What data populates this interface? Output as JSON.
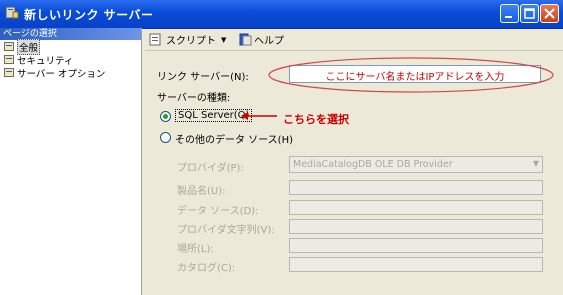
{
  "window": {
    "title": "新しいリンク サーバー"
  },
  "sidebar": {
    "header": "ページの選択",
    "items": [
      {
        "label": "全般"
      },
      {
        "label": "セキュリティ"
      },
      {
        "label": "サーバー オプション"
      }
    ]
  },
  "toolbar": {
    "script_label": "スクリプト",
    "help_label": "ヘルプ"
  },
  "form": {
    "linked_server_label": "リンク サーバー(N):",
    "linked_server_value": "ここにサーバ名またはIPアドレスを入力",
    "server_type_label": "サーバーの種類:",
    "sql_server_option": "SQL Server(Q)",
    "other_source_option": "その他のデータ ソース(H)",
    "annotation": "こちらを選択",
    "provider_label": "プロバイダ(P):",
    "provider_value": "MediaCatalogDB OLE DB Provider",
    "product_name_label": "製品名(U):",
    "data_source_label": "データ ソース(D):",
    "provider_string_label": "プロバイダ文字列(V):",
    "location_label": "場所(L):",
    "catalog_label": "カタログ(C):"
  },
  "colors": {
    "annotation": "#cc0000",
    "titlebar": "#0a4dd8",
    "radio_selected": "#21a121"
  }
}
